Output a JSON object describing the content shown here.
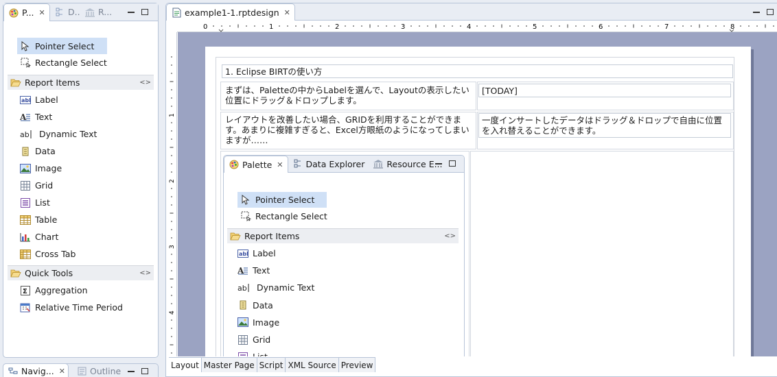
{
  "left_panel": {
    "tabs": [
      {
        "label": "P...",
        "icon": "palette-icon",
        "active": true
      },
      {
        "label": "D...",
        "icon": "data-explorer-icon",
        "active": false
      },
      {
        "label": "R...",
        "icon": "resource-explorer-icon",
        "active": false
      }
    ],
    "tools": [
      {
        "label": "Pointer Select",
        "icon": "pointer-icon",
        "selected": true
      },
      {
        "label": "Rectangle Select",
        "icon": "rectangle-select-icon",
        "selected": false
      }
    ],
    "report_items_drawer": "Report Items",
    "report_items": [
      {
        "label": "Label",
        "icon": "label-icon"
      },
      {
        "label": "Text",
        "icon": "text-icon"
      },
      {
        "label": "Dynamic Text",
        "icon": "dynamic-text-icon"
      },
      {
        "label": "Data",
        "icon": "data-icon"
      },
      {
        "label": "Image",
        "icon": "image-icon"
      },
      {
        "label": "Grid",
        "icon": "grid-icon"
      },
      {
        "label": "List",
        "icon": "list-icon"
      },
      {
        "label": "Table",
        "icon": "table-icon"
      },
      {
        "label": "Chart",
        "icon": "chart-icon"
      },
      {
        "label": "Cross Tab",
        "icon": "cross-tab-icon"
      }
    ],
    "quick_tools_drawer": "Quick Tools",
    "quick_tools": [
      {
        "label": "Aggregation",
        "icon": "sigma-icon"
      },
      {
        "label": "Relative Time Period",
        "icon": "calendar-icon"
      }
    ]
  },
  "bottom_left_tabs": [
    {
      "label": "Navig...",
      "icon": "navigator-icon",
      "active": true
    },
    {
      "label": "Outline",
      "icon": "outline-icon",
      "active": false
    }
  ],
  "editor": {
    "tab_label": "example1-1.rptdesign",
    "ruler_numbers": [
      "0",
      "1",
      "2",
      "3",
      "4",
      "5",
      "6",
      "7",
      "8"
    ],
    "vruler_numbers": [
      "1",
      "2",
      "3",
      "4"
    ],
    "report": {
      "heading": "1. Eclipse BIRTの使い方",
      "row1_left": "まずは、Paletteの中からLabelを選んで、Layoutの表示したい位置にドラッグ＆ドロップします。",
      "row1_right": "[TODAY]",
      "row2_left": "レイアウトを改善したい場合、GRIDを利用することができます。あまりに複雑すぎると、Excel方眼紙のようになってしまいますが……",
      "row2_right": "一度インサートしたデータはドラッグ＆ドロップで自由に位置を入れ替えることができます。"
    },
    "embedded_image": {
      "tabs": [
        {
          "label": "Palette",
          "icon": "palette-icon"
        },
        {
          "label": "Data Explorer",
          "icon": "data-explorer-icon"
        },
        {
          "label": "Resource E...",
          "icon": "resource-explorer-icon"
        }
      ],
      "tools": [
        {
          "label": "Pointer Select",
          "icon": "pointer-icon"
        },
        {
          "label": "Rectangle Select",
          "icon": "rectangle-select-icon"
        }
      ],
      "drawer": "Report Items",
      "items": [
        {
          "label": "Label",
          "icon": "label-icon"
        },
        {
          "label": "Text",
          "icon": "text-icon"
        },
        {
          "label": "Dynamic Text",
          "icon": "dynamic-text-icon"
        },
        {
          "label": "Data",
          "icon": "data-icon"
        },
        {
          "label": "Image",
          "icon": "image-icon"
        },
        {
          "label": "Grid",
          "icon": "grid-icon"
        },
        {
          "label": "List",
          "icon": "list-icon"
        }
      ]
    },
    "bottom_tabs": [
      "Layout",
      "Master Page",
      "Script",
      "XML Source",
      "Preview"
    ],
    "active_bottom_tab": "Layout"
  }
}
